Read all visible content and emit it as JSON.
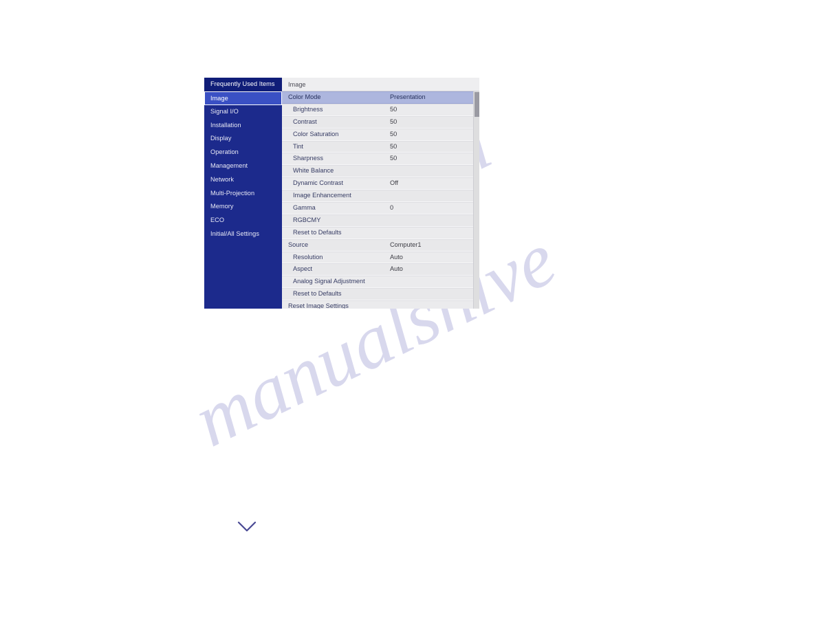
{
  "osd": {
    "sidebar": {
      "header": {
        "label": "Frequently Used Items"
      },
      "items": [
        {
          "label": "Image",
          "selected": true
        },
        {
          "label": "Signal I/O",
          "selected": false
        },
        {
          "label": "Installation",
          "selected": false
        },
        {
          "label": "Display",
          "selected": false
        },
        {
          "label": "Operation",
          "selected": false
        },
        {
          "label": "Management",
          "selected": false
        },
        {
          "label": "Network",
          "selected": false
        },
        {
          "label": "Multi-Projection",
          "selected": false
        },
        {
          "label": "Memory",
          "selected": false
        },
        {
          "label": "ECO",
          "selected": false
        },
        {
          "label": "Initial/All Settings",
          "selected": false
        }
      ]
    },
    "pane": {
      "title": "Image",
      "rows": [
        {
          "label": "Color Mode",
          "value": "Presentation",
          "top": true,
          "selected": true
        },
        {
          "label": "Brightness",
          "value": "50",
          "top": false,
          "selected": false
        },
        {
          "label": "Contrast",
          "value": "50",
          "top": false,
          "selected": false
        },
        {
          "label": "Color Saturation",
          "value": "50",
          "top": false,
          "selected": false
        },
        {
          "label": "Tint",
          "value": "50",
          "top": false,
          "selected": false
        },
        {
          "label": "Sharpness",
          "value": "50",
          "top": false,
          "selected": false
        },
        {
          "label": "White Balance",
          "value": "",
          "top": false,
          "selected": false
        },
        {
          "label": "Dynamic Contrast",
          "value": "Off",
          "top": false,
          "selected": false
        },
        {
          "label": "Image Enhancement",
          "value": "",
          "top": false,
          "selected": false
        },
        {
          "label": "Gamma",
          "value": "0",
          "top": false,
          "selected": false
        },
        {
          "label": "RGBCMY",
          "value": "",
          "top": false,
          "selected": false
        },
        {
          "label": "Reset to Defaults",
          "value": "",
          "top": false,
          "selected": false
        },
        {
          "label": "Source",
          "value": "Computer1",
          "top": true,
          "selected": false
        },
        {
          "label": "Resolution",
          "value": "Auto",
          "top": false,
          "selected": false
        },
        {
          "label": "Aspect",
          "value": "Auto",
          "top": false,
          "selected": false
        },
        {
          "label": "Analog Signal Adjustment",
          "value": "",
          "top": false,
          "selected": false
        },
        {
          "label": "Reset to Defaults",
          "value": "",
          "top": false,
          "selected": false
        },
        {
          "label": "Reset Image Settings",
          "value": "",
          "top": true,
          "selected": false
        }
      ]
    },
    "colors": {
      "sidebar_bg": "#1c2a8c",
      "sidebar_header_bg": "#101d78",
      "selected_nav_bg": "#3a50c4",
      "row_bg": "#e8e8ea",
      "selected_row_bg": "#adb6de",
      "label_text": "#353b63"
    }
  },
  "page": {
    "chevron": "chevron-down"
  },
  "watermark": {
    "line_a": "manualshive",
    "line_b": ".com"
  }
}
